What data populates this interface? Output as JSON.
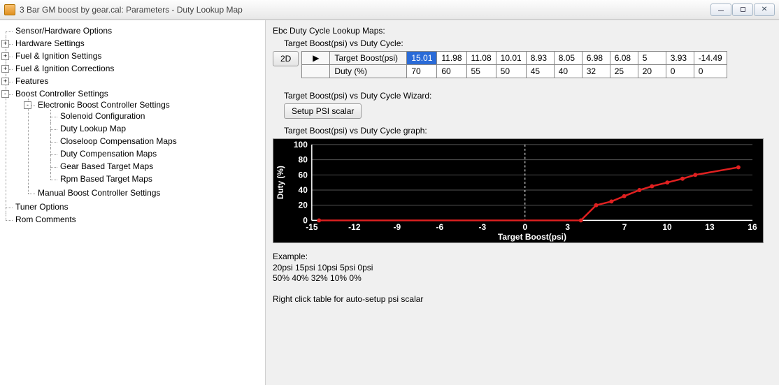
{
  "window": {
    "title": "3 Bar GM boost by gear.cal: Parameters - Duty Lookup Map"
  },
  "tree": {
    "items": [
      {
        "label": "Sensor/Hardware Options",
        "exp": ""
      },
      {
        "label": "Hardware Settings",
        "exp": "+"
      },
      {
        "label": "Fuel & Ignition Settings",
        "exp": "+"
      },
      {
        "label": "Fuel & Ignition Corrections",
        "exp": "+"
      },
      {
        "label": "Features",
        "exp": "+"
      },
      {
        "label": "Boost Controller Settings",
        "exp": "-",
        "children": [
          {
            "label": "Electronic Boost Controller Settings",
            "exp": "-",
            "children": [
              {
                "label": "Solenoid Configuration"
              },
              {
                "label": "Duty Lookup Map"
              },
              {
                "label": "Closeloop Compensation Maps"
              },
              {
                "label": "Duty Compensation Maps"
              },
              {
                "label": "Gear Based Target Maps"
              },
              {
                "label": "Rpm Based Target Maps"
              }
            ]
          },
          {
            "label": "Manual Boost Controller Settings"
          }
        ]
      },
      {
        "label": "Tuner Options",
        "exp": ""
      },
      {
        "label": "Rom Comments",
        "exp": ""
      }
    ]
  },
  "content": {
    "heading": "Ebc Duty Cycle Lookup Maps:",
    "table_label": "Target Boost(psi) vs Duty Cycle:",
    "btn2d": "2D",
    "row1_label": "Target Boost(psi)",
    "row2_label": "Duty (%)",
    "boost_values": [
      "15.01",
      "11.98",
      "11.08",
      "10.01",
      "8.93",
      "8.05",
      "6.98",
      "6.08",
      "5",
      "3.93",
      "-14.49"
    ],
    "duty_values": [
      "70",
      "60",
      "55",
      "50",
      "45",
      "40",
      "32",
      "25",
      "20",
      "0",
      "0"
    ],
    "wizard_label": "Target Boost(psi) vs Duty Cycle Wizard:",
    "wizard_btn": "Setup PSI scalar",
    "graph_label": "Target Boost(psi) vs Duty Cycle graph:",
    "example_heading": "Example:",
    "example_line1": "20psi 15psi 10psi 5psi 0psi",
    "example_line2": "50%  40%  32% 10%   0%",
    "hint": "Right click table for auto-setup psi scalar"
  },
  "chart_data": {
    "type": "line",
    "title": "",
    "xlabel": "Target Boost(psi)",
    "ylabel": "Duty (%)",
    "xlim": [
      -15,
      16
    ],
    "ylim": [
      0,
      100
    ],
    "xticks": [
      -15,
      -12,
      -9,
      -6,
      -3,
      0,
      3,
      7,
      10,
      13,
      16
    ],
    "yticks": [
      0,
      20,
      40,
      60,
      80,
      100
    ],
    "series": [
      {
        "name": "Duty",
        "x": [
          -14.49,
          3.93,
          5,
          6.08,
          6.98,
          8.05,
          8.93,
          10.01,
          11.08,
          11.98,
          15.01
        ],
        "y": [
          0,
          0,
          20,
          25,
          32,
          40,
          45,
          50,
          55,
          60,
          70
        ]
      }
    ]
  }
}
